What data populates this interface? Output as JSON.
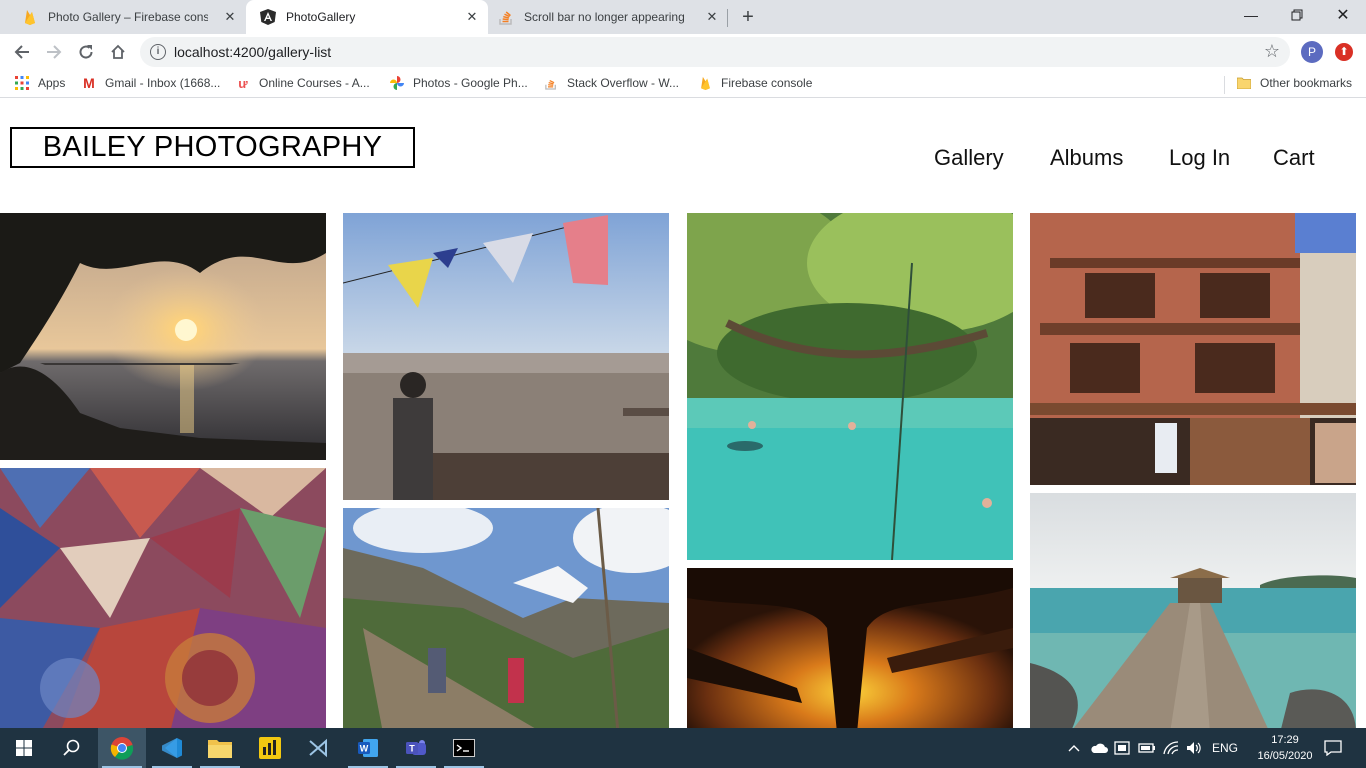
{
  "browser": {
    "tabs": [
      {
        "title": "Photo Gallery – Firebase console",
        "active": false
      },
      {
        "title": "PhotoGallery",
        "active": true
      },
      {
        "title": "Scroll bar no longer appearing -",
        "active": false
      }
    ],
    "url": "localhost:4200/gallery-list",
    "profile_initial": "P",
    "bookmarks": [
      {
        "label": "Apps",
        "icon": "apps-grid-icon"
      },
      {
        "label": "Gmail - Inbox (1668...",
        "icon": "gmail-icon"
      },
      {
        "label": "Online Courses - A...",
        "icon": "udemy-icon"
      },
      {
        "label": "Photos - Google Ph...",
        "icon": "google-photos-icon"
      },
      {
        "label": "Stack Overflow - W...",
        "icon": "stackoverflow-icon"
      },
      {
        "label": "Firebase console",
        "icon": "firebase-icon"
      }
    ],
    "other_bookmarks": "Other bookmarks"
  },
  "site": {
    "brand": "BAILEY PHOTOGRAPHY",
    "nav": [
      "Gallery",
      "Albums",
      "Log In",
      "Cart"
    ]
  },
  "gallery": [
    {
      "subject": "sunset-over-sea"
    },
    {
      "subject": "patchwork-fabric"
    },
    {
      "subject": "prayer-flags-city-view"
    },
    {
      "subject": "mountain-trail-hikers"
    },
    {
      "subject": "turquoise-lagoon-swimmers"
    },
    {
      "subject": "glowing-cave"
    },
    {
      "subject": "red-brick-building-masks"
    },
    {
      "subject": "wooden-pier-sea"
    }
  ],
  "taskbar": {
    "language": "ENG",
    "time": "17:29",
    "date": "16/05/2020"
  },
  "colors": {
    "tabbar_bg": "#dee1e6",
    "taskbar_bg": "#1f3341",
    "profile_bg": "#5c6bc0"
  }
}
